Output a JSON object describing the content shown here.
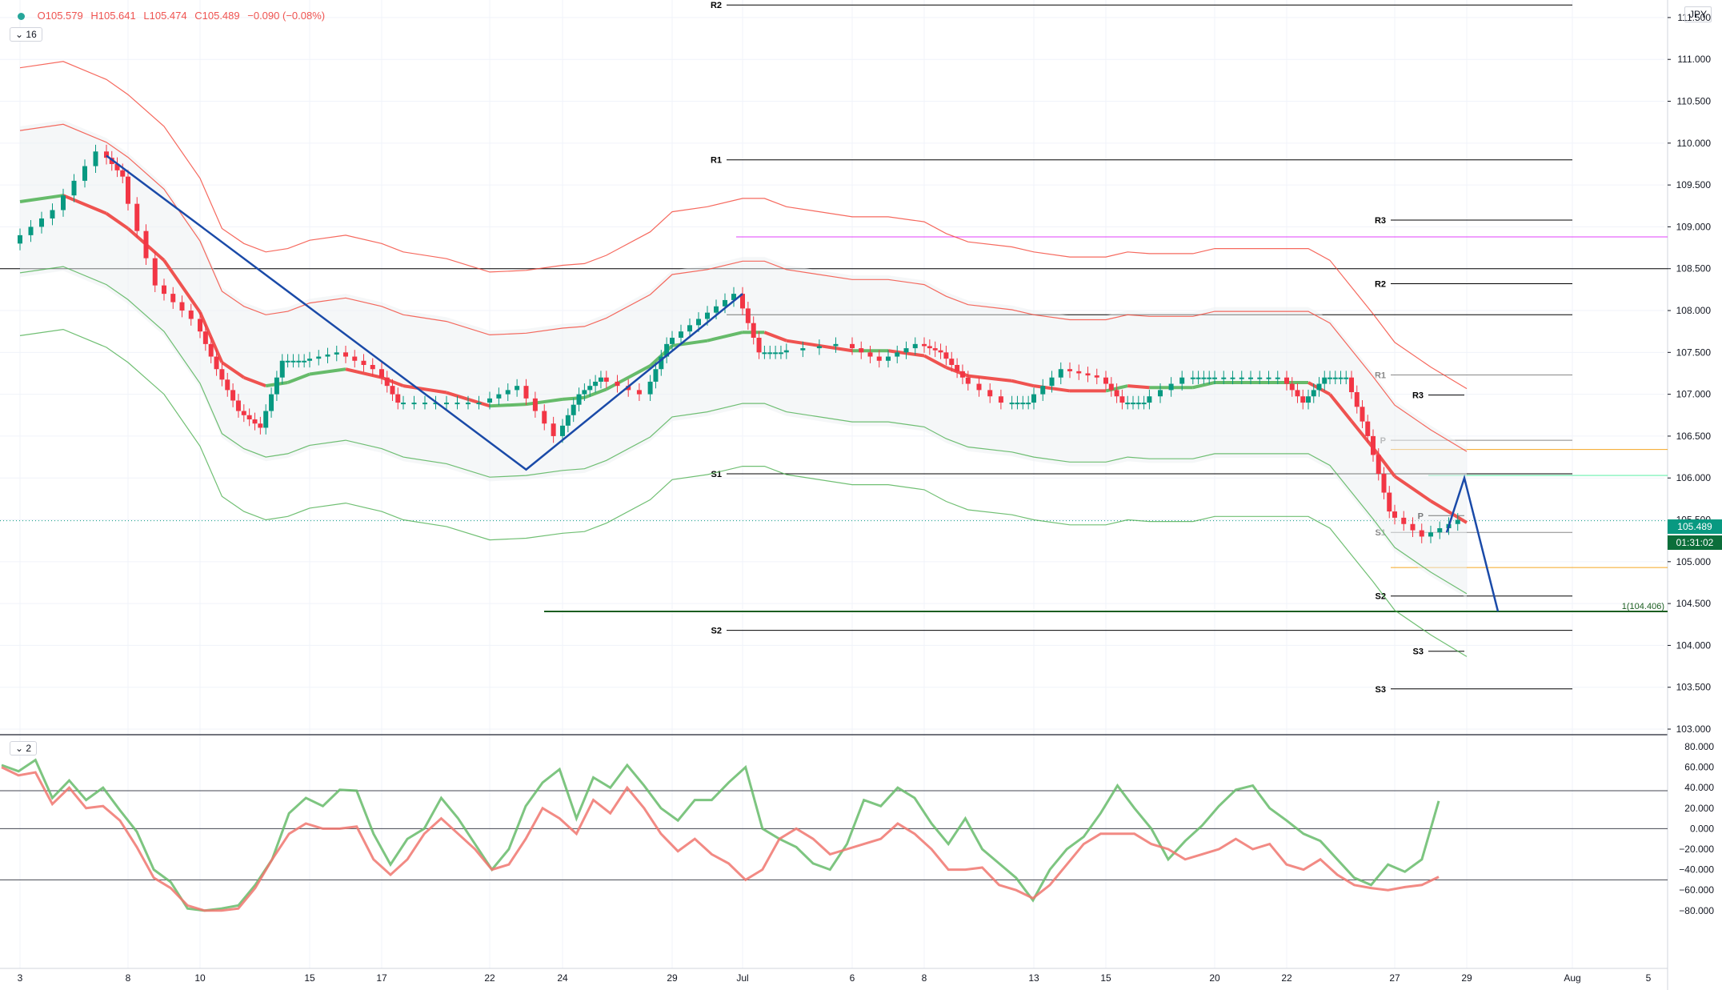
{
  "instrument": {
    "currency": "JPY"
  },
  "legend": {
    "open": "O105.579",
    "high": "H105.641",
    "low": "L105.474",
    "close": "C105.489",
    "change": "−0.090 (−0.08%)",
    "indicator_count_main": "16",
    "indicator_count_osc": "2"
  },
  "last_price": {
    "value": "105.489",
    "countdown": "01:31:02"
  },
  "colors": {
    "up": "#089981",
    "down": "#f23645",
    "band_up": "#4caf50",
    "band_down": "#f44336",
    "pattern": "#1a4aa8",
    "target_line": "#1b5e20"
  },
  "chart_data": [
    {
      "type": "candlestick",
      "symbol_currency": "JPY",
      "y_ticks": [
        "111.500",
        "111.000",
        "110.500",
        "110.000",
        "109.500",
        "109.000",
        "108.500",
        "108.000",
        "107.500",
        "107.000",
        "106.500",
        "106.000",
        "105.500",
        "105.000",
        "104.500",
        "104.000",
        "103.500",
        "103.000"
      ],
      "x_ticks": [
        "3",
        "8",
        "10",
        "15",
        "17",
        "22",
        "24",
        "29",
        "Jul",
        "6",
        "8",
        "13",
        "15",
        "20",
        "22",
        "27",
        "29",
        "Aug",
        "5"
      ],
      "ylim": [
        103.0,
        111.7
      ],
      "close_path": [
        {
          "d": "Jun 3",
          "v": 108.8
        },
        {
          "d": "Jun 5",
          "v": 109.2
        },
        {
          "d": "Jun 7",
          "v": 109.9
        },
        {
          "d": "Jun 8",
          "v": 109.6
        },
        {
          "d": "Jun 9",
          "v": 108.3
        },
        {
          "d": "Jun 10",
          "v": 107.9
        },
        {
          "d": "Jun 11",
          "v": 107.3
        },
        {
          "d": "Jun 12",
          "v": 106.8
        },
        {
          "d": "Jun 13",
          "v": 106.6
        },
        {
          "d": "Jun 14",
          "v": 107.4
        },
        {
          "d": "Jun 15",
          "v": 107.4
        },
        {
          "d": "Jun 16",
          "v": 107.5
        },
        {
          "d": "Jun 17",
          "v": 107.3
        },
        {
          "d": "Jun 18",
          "v": 106.9
        },
        {
          "d": "Jun 20",
          "v": 106.9
        },
        {
          "d": "Jun 22",
          "v": 106.9
        },
        {
          "d": "Jun 23",
          "v": 107.1
        },
        {
          "d": "Jun 24",
          "v": 106.5
        },
        {
          "d": "Jun 25",
          "v": 107.0
        },
        {
          "d": "Jun 26",
          "v": 107.2
        },
        {
          "d": "Jun 28",
          "v": 107.0
        },
        {
          "d": "Jun 29",
          "v": 107.6
        },
        {
          "d": "Jun 30",
          "v": 107.9
        },
        {
          "d": "Jul 1",
          "v": 108.2
        },
        {
          "d": "Jul 2",
          "v": 107.5
        },
        {
          "d": "Jul 3",
          "v": 107.5
        },
        {
          "d": "Jul 6",
          "v": 107.6
        },
        {
          "d": "Jul 7",
          "v": 107.4
        },
        {
          "d": "Jul 8",
          "v": 107.6
        },
        {
          "d": "Jul 9",
          "v": 107.5
        },
        {
          "d": "Jul 10",
          "v": 107.2
        },
        {
          "d": "Jul 12",
          "v": 106.9
        },
        {
          "d": "Jul 13",
          "v": 106.9
        },
        {
          "d": "Jul 14",
          "v": 107.3
        },
        {
          "d": "Jul 15",
          "v": 107.2
        },
        {
          "d": "Jul 16",
          "v": 106.9
        },
        {
          "d": "Jul 17",
          "v": 106.9
        },
        {
          "d": "Jul 19",
          "v": 107.2
        },
        {
          "d": "Jul 20",
          "v": 107.2
        },
        {
          "d": "Jul 21",
          "v": 107.2
        },
        {
          "d": "Jul 22",
          "v": 107.2
        },
        {
          "d": "Jul 23",
          "v": 106.9
        },
        {
          "d": "Jul 24",
          "v": 107.2
        },
        {
          "d": "Jul 25",
          "v": 107.2
        },
        {
          "d": "Jul 26",
          "v": 106.5
        },
        {
          "d": "Jul 27",
          "v": 105.6
        },
        {
          "d": "Jul 28",
          "v": 105.3
        },
        {
          "d": "Jul 29",
          "v": 105.5
        }
      ],
      "levels": [
        {
          "label": "R2",
          "value": 111.65
        },
        {
          "label": "R1",
          "value": 109.8
        },
        {
          "label": "S1",
          "value": 106.05
        },
        {
          "label": "S2",
          "value": 104.18
        },
        {
          "label": "R3",
          "value": 109.08
        },
        {
          "label": "R2",
          "value": 108.32
        },
        {
          "label": "R1",
          "value": 107.23
        },
        {
          "label": "R3",
          "value": 106.99
        },
        {
          "label": "P",
          "value": 106.45
        },
        {
          "label": "P",
          "value": 105.55
        },
        {
          "label": "S1",
          "value": 105.35
        },
        {
          "label": "S2",
          "value": 104.59
        },
        {
          "label": "S3",
          "value": 103.93
        },
        {
          "label": "S3",
          "value": 103.48
        }
      ],
      "horizontal_lines": [
        108.5,
        107.95,
        108.88,
        106.34,
        104.93
      ],
      "target_label": "1(104.406)",
      "target_value": 104.406
    },
    {
      "type": "line",
      "title": "",
      "y_ticks": [
        "80.000",
        "60.000",
        "40.000",
        "20.000",
        "0.000",
        "−20.000",
        "−40.000",
        "−60.000",
        "−80.000"
      ],
      "ylim": [
        -93,
        83
      ],
      "hlines": [
        37,
        0,
        -50
      ],
      "series": [
        {
          "color": "#66bb6a",
          "values": [
            62,
            56,
            67,
            30,
            47,
            28,
            40,
            18,
            -3,
            -40,
            -52,
            -78,
            -80,
            -78,
            -75,
            -55,
            -30,
            15,
            30,
            22,
            38,
            37,
            -5,
            -35,
            -10,
            0,
            30,
            10,
            -15,
            -40,
            -20,
            22,
            45,
            58,
            10,
            50,
            40,
            62,
            42,
            20,
            8,
            28,
            28,
            45,
            60,
            0,
            -10,
            -18,
            -34,
            -40,
            -15,
            28,
            22,
            40,
            30,
            5,
            -15,
            10,
            -20,
            -34,
            -48,
            -70,
            -40,
            -20,
            -8,
            15,
            42,
            20,
            0,
            -30,
            -12,
            3,
            22,
            38,
            42,
            20,
            8,
            -5,
            -12,
            -30,
            -48,
            -55,
            -35,
            -42,
            -30,
            27
          ]
        },
        {
          "color": "#f0766e",
          "values": [
            60,
            52,
            55,
            24,
            40,
            20,
            22,
            8,
            -18,
            -48,
            -58,
            -75,
            -80,
            -80,
            -78,
            -58,
            -30,
            -5,
            5,
            0,
            0,
            2,
            -30,
            -45,
            -30,
            -5,
            10,
            -5,
            -20,
            -40,
            -35,
            -10,
            20,
            10,
            -5,
            28,
            15,
            40,
            20,
            -5,
            -22,
            -10,
            -25,
            -34,
            -50,
            -40,
            -10,
            0,
            -10,
            -25,
            -20,
            -15,
            -10,
            5,
            -5,
            -20,
            -40,
            -40,
            -38,
            -55,
            -60,
            -68,
            -55,
            -35,
            -15,
            -5,
            -5,
            -5,
            -15,
            -20,
            -30,
            -25,
            -20,
            -10,
            -20,
            -15,
            -35,
            -40,
            -30,
            -45,
            -55,
            -58,
            -60,
            -57,
            -55,
            -47
          ]
        }
      ]
    }
  ]
}
